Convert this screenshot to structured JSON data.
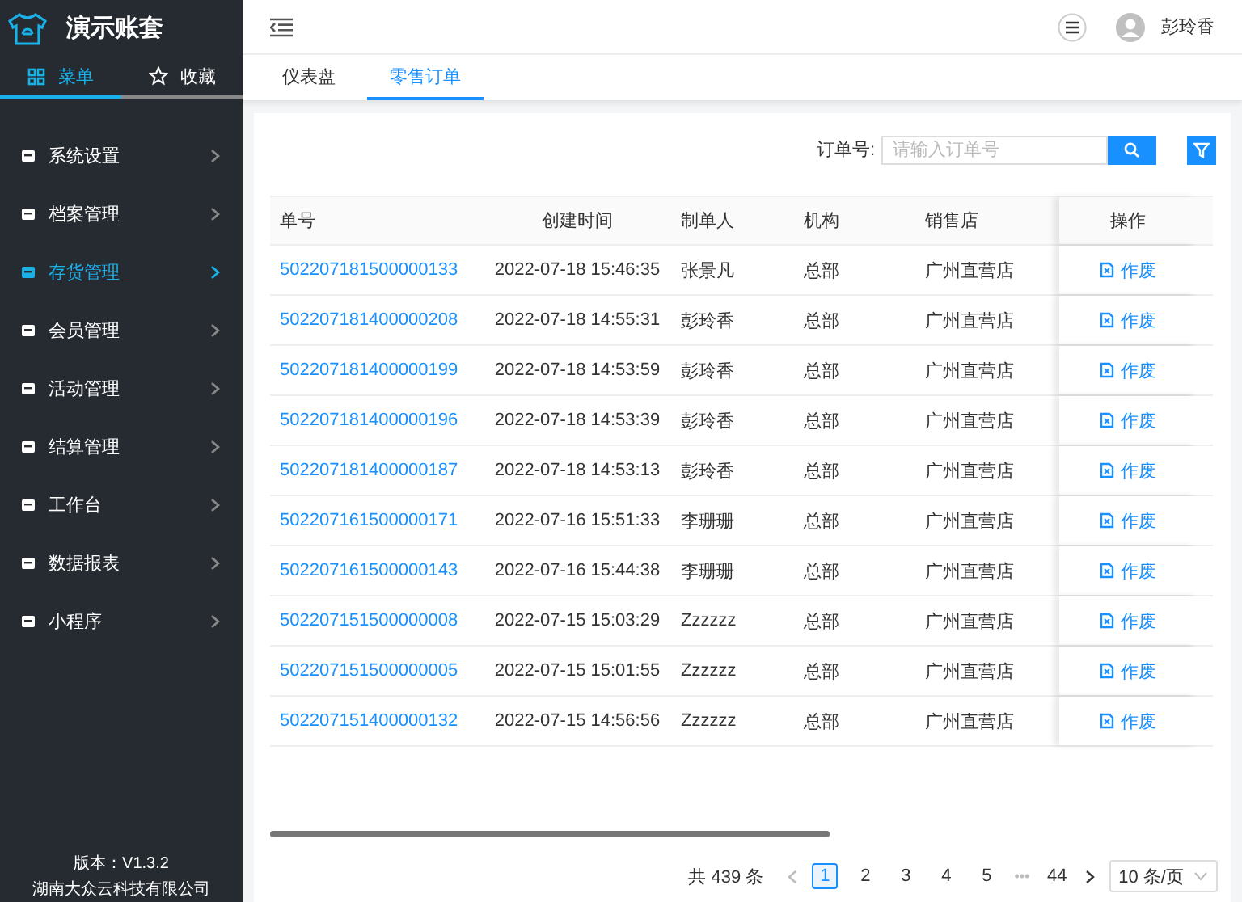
{
  "app": {
    "title": "演示账套"
  },
  "sidebar_tabs": [
    {
      "label": "菜单",
      "selected": true
    },
    {
      "label": "收藏",
      "selected": false
    }
  ],
  "menu": [
    {
      "label": "系统设置",
      "selected": false
    },
    {
      "label": "档案管理",
      "selected": false
    },
    {
      "label": "存货管理",
      "selected": true
    },
    {
      "label": "会员管理",
      "selected": false
    },
    {
      "label": "活动管理",
      "selected": false
    },
    {
      "label": "结算管理",
      "selected": false
    },
    {
      "label": "工作台",
      "selected": false
    },
    {
      "label": "数据报表",
      "selected": false
    },
    {
      "label": "小程序",
      "selected": false
    }
  ],
  "sidebar_footer": {
    "version": "版本：V1.3.2",
    "company": "湖南大众云科技有限公司"
  },
  "header": {
    "user": "彭玲香"
  },
  "tabs": [
    {
      "label": "仪表盘",
      "selected": false
    },
    {
      "label": "零售订单",
      "selected": true
    }
  ],
  "search": {
    "label": "订单号:",
    "placeholder": "请输入订单号"
  },
  "table": {
    "columns": [
      "单号",
      "创建时间",
      "制单人",
      "机构",
      "销售店"
    ],
    "action_column": "操作",
    "rows": [
      {
        "cells": [
          "502207181500000133",
          "2022-07-18 15:46:35",
          "张景凡",
          "总部",
          "广州直营店"
        ],
        "action": "作废"
      },
      {
        "cells": [
          "502207181400000208",
          "2022-07-18 14:55:31",
          "彭玲香",
          "总部",
          "广州直营店"
        ],
        "action": "作废"
      },
      {
        "cells": [
          "502207181400000199",
          "2022-07-18 14:53:59",
          "彭玲香",
          "总部",
          "广州直营店"
        ],
        "action": "作废"
      },
      {
        "cells": [
          "502207181400000196",
          "2022-07-18 14:53:39",
          "彭玲香",
          "总部",
          "广州直营店"
        ],
        "action": "作废"
      },
      {
        "cells": [
          "502207181400000187",
          "2022-07-18 14:53:13",
          "彭玲香",
          "总部",
          "广州直营店"
        ],
        "action": "作废"
      },
      {
        "cells": [
          "502207161500000171",
          "2022-07-16 15:51:33",
          "李珊珊",
          "总部",
          "广州直营店"
        ],
        "action": "作废"
      },
      {
        "cells": [
          "502207161500000143",
          "2022-07-16 15:44:38",
          "李珊珊",
          "总部",
          "广州直营店"
        ],
        "action": "作废"
      },
      {
        "cells": [
          "502207151500000008",
          "2022-07-15 15:03:29",
          "Zzzzzz",
          "总部",
          "广州直营店"
        ],
        "action": "作废"
      },
      {
        "cells": [
          "502207151500000005",
          "2022-07-15 15:01:55",
          "Zzzzzz",
          "总部",
          "广州直营店"
        ],
        "action": "作废"
      },
      {
        "cells": [
          "502207151400000132",
          "2022-07-15 14:56:56",
          "Zzzzzz",
          "总部",
          "广州直营店"
        ],
        "action": "作废"
      }
    ]
  },
  "pagination": {
    "total": "共 439 条",
    "pages": [
      {
        "label": "1",
        "selected": true
      },
      {
        "label": "2",
        "selected": false
      },
      {
        "label": "3",
        "selected": false
      },
      {
        "label": "4",
        "selected": false
      },
      {
        "label": "5",
        "selected": false
      }
    ],
    "ellipsis": "•••",
    "last": {
      "label": "44",
      "selected": false
    },
    "page_size": "10 条/页"
  }
}
